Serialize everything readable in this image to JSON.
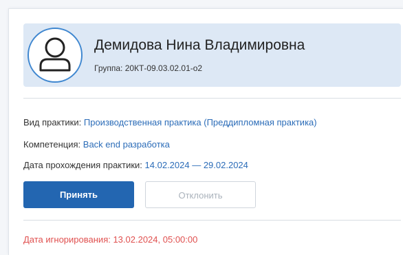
{
  "student": {
    "name": "Демидова Нина Владимировна",
    "group": "Группа: 20КТ-09.03.02.01-о2"
  },
  "details": {
    "practice_label": "Вид практики:",
    "practice_value": "Производственная практика (Преддипломная практика)",
    "competence_label": "Компетенция:",
    "competence_value": "Back end разработка",
    "dates_label": "Дата прохождения практики:",
    "dates_value": "14.02.2024 — 29.02.2024"
  },
  "actions": {
    "accept_label": "Принять",
    "reject_label": "Отклонить"
  },
  "ignore_date": "Дата игнорирования: 13.02.2024, 05:00:00",
  "icons": {
    "avatar": "user-outline-icon"
  },
  "colors": {
    "accent": "#2366b1",
    "link": "#2b6cb8",
    "profile_bg": "#dde8f5",
    "danger": "#e0504f"
  }
}
